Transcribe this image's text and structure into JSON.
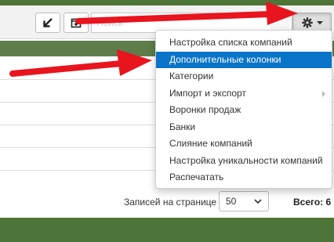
{
  "toolbar": {
    "search_placeholder": "Поиск",
    "icons": [
      "arrow-down-left-icon",
      "add-document-icon",
      "gear-icon",
      "caret-down-icon"
    ]
  },
  "settings_menu": {
    "items": [
      {
        "label": "Настройка списка компаний"
      },
      {
        "label": "Дополнительные колонки",
        "active": true
      },
      {
        "label": "Категории"
      },
      {
        "label": "Импорт и экспорт",
        "has_submenu": true
      },
      {
        "label": "Воронки продаж"
      },
      {
        "label": "Банки"
      },
      {
        "label": "Слияние компаний"
      },
      {
        "label": "Настройка уникальности компаний"
      },
      {
        "label": "Распечатать"
      }
    ]
  },
  "footer": {
    "records_per_page_label": "Записей на странице",
    "page_size": "50",
    "total": "Всего: 6"
  },
  "colors": {
    "frame_green": "#4e7538",
    "header_green": "#5e7d4a",
    "highlight_blue": "#0a74c9",
    "annotation_red": "#e8141e"
  }
}
